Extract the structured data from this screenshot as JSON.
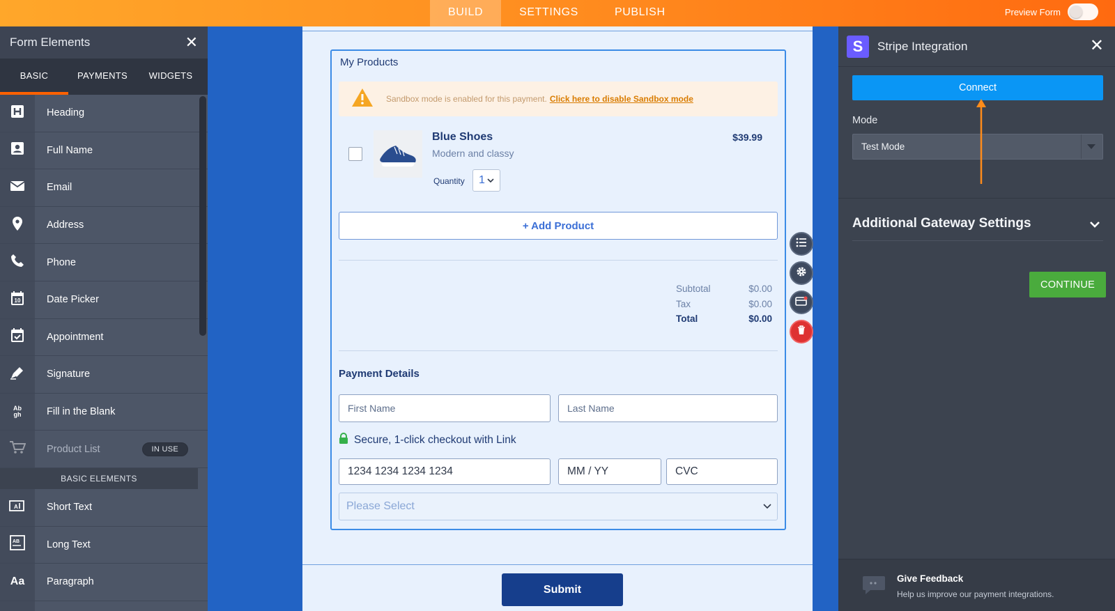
{
  "topbar": {
    "tabs": [
      "BUILD",
      "SETTINGS",
      "PUBLISH"
    ],
    "preview_label": "Preview Form"
  },
  "left_panel": {
    "title": "Form Elements",
    "tabs": [
      "BASIC",
      "PAYMENTS",
      "WIDGETS"
    ],
    "items": [
      {
        "label": "Heading",
        "icon": "heading-icon"
      },
      {
        "label": "Full Name",
        "icon": "person-icon"
      },
      {
        "label": "Email",
        "icon": "envelope-icon"
      },
      {
        "label": "Address",
        "icon": "location-pin-icon"
      },
      {
        "label": "Phone",
        "icon": "phone-icon"
      },
      {
        "label": "Date Picker",
        "icon": "calendar-icon"
      },
      {
        "label": "Appointment",
        "icon": "calendar-check-icon"
      },
      {
        "label": "Signature",
        "icon": "pen-icon"
      },
      {
        "label": "Fill in the Blank",
        "icon": "fill-blank-icon"
      },
      {
        "label": "Product List",
        "icon": "cart-icon",
        "badge": "IN USE"
      }
    ],
    "section_header": "BASIC ELEMENTS",
    "basic_items": [
      {
        "label": "Short Text",
        "icon": "short-text-icon"
      },
      {
        "label": "Long Text",
        "icon": "long-text-icon"
      },
      {
        "label": "Paragraph",
        "icon": "paragraph-icon"
      }
    ],
    "paragraph_glyph": "Aa",
    "fill_glyph_top": "Ab",
    "fill_glyph_bottom": "gh"
  },
  "form": {
    "widget_title": "My Products",
    "sandbox_text": "Sandbox mode is enabled for this payment.",
    "sandbox_link": "Click here to disable Sandbox mode",
    "product": {
      "name": "Blue Shoes",
      "description": "Modern and classy",
      "price": "$39.99",
      "quantity_label": "Quantity",
      "quantity_value": "1"
    },
    "add_product": "+ Add Product",
    "totals": [
      {
        "label": "Subtotal",
        "value": "$0.00"
      },
      {
        "label": "Tax",
        "value": "$0.00"
      },
      {
        "label": "Total",
        "value": "$0.00"
      }
    ],
    "payment_title": "Payment Details",
    "first_name_placeholder": "First Name",
    "last_name_placeholder": "Last Name",
    "secure_text": "Secure, 1-click checkout with Link",
    "card_placeholder": "1234 1234 1234 1234",
    "expiry_placeholder": "MM / YY",
    "cvc_placeholder": "CVC",
    "select_placeholder": "Please Select",
    "submit": "Submit"
  },
  "right_panel": {
    "logo_letter": "S",
    "title": "Stripe Integration",
    "connect": "Connect",
    "mode_label": "Mode",
    "mode_value": "Test Mode",
    "additional_settings": "Additional Gateway Settings",
    "continue": "CONTINUE",
    "feedback_title": "Give Feedback",
    "feedback_subtitle": "Help us improve our payment integrations."
  },
  "colors": {
    "topbar_accent": "#ff8a1e",
    "connect_blue": "#0a96f5",
    "continue_green": "#4aab3d",
    "submit_navy": "#163e8c",
    "delete_red": "#de3232",
    "stripe_purple": "#6a5cff"
  }
}
